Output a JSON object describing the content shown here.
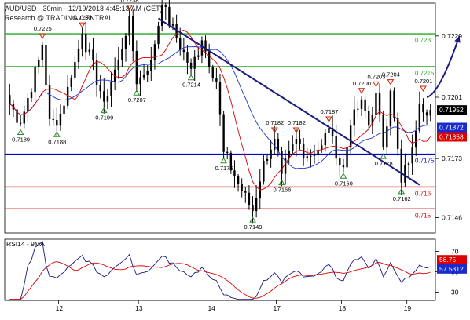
{
  "header": {
    "instrument_line": "AUD/USD - 30min - 12/19/2018 4:45:13 AM (CET)",
    "research_line": "Research @ TRADING CENTRAL"
  },
  "colors": {
    "candle": "#000000",
    "ma_fast": "#dd0000",
    "ma_slow": "#2233cc",
    "trendline": "#1a1a80",
    "resistance": "#22aa22",
    "pivot": "#0000cc",
    "support": "#cc0000",
    "marker_up": "#2a8a2a",
    "marker_down": "#cc2200",
    "badge_price": "#000000",
    "badge_slow": "#1a2acc",
    "badge_fast": "#dd0000",
    "rsi_line": "#1a1a80",
    "rsi_ma": "#dd0000"
  },
  "chart_data": [
    {
      "type": "candlestick",
      "title": "AUD/USD - 30min",
      "ylim": [
        0.7139,
        0.7244
      ],
      "x_tick_labels": [
        "12",
        "13",
        "14",
        "17",
        "18",
        "19"
      ],
      "y_tick_labels": [
        {
          "label": "0.7229",
          "value": 0.7229
        },
        {
          "label": "0.7201",
          "value": 0.7201
        },
        {
          "label": "0.7173",
          "value": 0.7173
        },
        {
          "label": "0.7146",
          "value": 0.7146
        }
      ],
      "anchor_points": [
        {
          "bar": 0,
          "price": 0.7198
        },
        {
          "bar": 3,
          "price": 0.7189
        },
        {
          "bar": 8,
          "price": 0.7218
        },
        {
          "bar": 9,
          "price": 0.7225
        },
        {
          "bar": 11,
          "price": 0.7191
        },
        {
          "bar": 13,
          "price": 0.7188
        },
        {
          "bar": 17,
          "price": 0.721
        },
        {
          "bar": 20,
          "price": 0.723
        },
        {
          "bar": 26,
          "price": 0.7199
        },
        {
          "bar": 30,
          "price": 0.7218
        },
        {
          "bar": 33,
          "price": 0.7238
        },
        {
          "bar": 35,
          "price": 0.7207
        },
        {
          "bar": 39,
          "price": 0.7218
        },
        {
          "bar": 42,
          "price": 0.7243
        },
        {
          "bar": 46,
          "price": 0.7228
        },
        {
          "bar": 50,
          "price": 0.7214
        },
        {
          "bar": 53,
          "price": 0.7227
        },
        {
          "bar": 57,
          "price": 0.7208
        },
        {
          "bar": 59,
          "price": 0.7176
        },
        {
          "bar": 64,
          "price": 0.7158
        },
        {
          "bar": 67,
          "price": 0.7149
        },
        {
          "bar": 70,
          "price": 0.7172
        },
        {
          "bar": 73,
          "price": 0.7182
        },
        {
          "bar": 75,
          "price": 0.7166
        },
        {
          "bar": 79,
          "price": 0.7182
        },
        {
          "bar": 82,
          "price": 0.7174
        },
        {
          "bar": 86,
          "price": 0.7179
        },
        {
          "bar": 88,
          "price": 0.7187
        },
        {
          "bar": 90,
          "price": 0.7173
        },
        {
          "bar": 92,
          "price": 0.7169
        },
        {
          "bar": 94,
          "price": 0.7188
        },
        {
          "bar": 97,
          "price": 0.72
        },
        {
          "bar": 99,
          "price": 0.7188
        },
        {
          "bar": 101,
          "price": 0.7203
        },
        {
          "bar": 103,
          "price": 0.7178
        },
        {
          "bar": 105,
          "price": 0.7204
        },
        {
          "bar": 108,
          "price": 0.7162
        },
        {
          "bar": 111,
          "price": 0.7178
        },
        {
          "bar": 113,
          "price": 0.7198
        },
        {
          "bar": 116,
          "price": 0.7195
        }
      ],
      "bars_count": 117,
      "day_start_bars": {
        "12": 14,
        "13": 36,
        "14": 56,
        "17": 74,
        "18": 92,
        "19": 110
      },
      "horizontal_levels": [
        {
          "label": "0.723",
          "value": 0.723,
          "role": "resistance"
        },
        {
          "label": "0.7215",
          "value": 0.7215,
          "role": "resistance"
        },
        {
          "label": "0.7175",
          "value": 0.7175,
          "role": "pivot"
        },
        {
          "label": "0.716",
          "value": 0.716,
          "role": "support"
        },
        {
          "label": "0.715",
          "value": 0.715,
          "role": "support"
        }
      ],
      "trendline": [
        {
          "bar": 41,
          "price": 0.7237
        },
        {
          "bar": 113,
          "price": 0.7161
        }
      ],
      "projection_arrow": [
        {
          "bar": 115,
          "price": 0.7201
        },
        {
          "bar": 124,
          "price": 0.7229
        }
      ],
      "annotations": [
        {
          "label": "0.7225",
          "bar": 9,
          "price": 0.7225,
          "kind": "high"
        },
        {
          "label": "0.7230",
          "bar": 20,
          "price": 0.723,
          "kind": "high"
        },
        {
          "label": "0.7238",
          "bar": 33,
          "price": 0.7238,
          "kind": "high"
        },
        {
          "label": "0.7189",
          "bar": 3,
          "price": 0.7189,
          "kind": "low"
        },
        {
          "label": "0.7188",
          "bar": 13,
          "price": 0.7188,
          "kind": "low"
        },
        {
          "label": "0.7199",
          "bar": 26,
          "price": 0.7199,
          "kind": "low"
        },
        {
          "label": "0.7207",
          "bar": 35,
          "price": 0.7207,
          "kind": "low"
        },
        {
          "label": "0.7214",
          "bar": 50,
          "price": 0.7214,
          "kind": "low"
        },
        {
          "label": "0.7176",
          "bar": 59,
          "price": 0.7176,
          "kind": "low"
        },
        {
          "label": "0.7149",
          "bar": 67,
          "price": 0.7149,
          "kind": "low"
        },
        {
          "label": "0.7182",
          "bar": 73,
          "price": 0.7182,
          "kind": "high"
        },
        {
          "label": "0.7182",
          "bar": 79,
          "price": 0.7182,
          "kind": "high"
        },
        {
          "label": "0.7166",
          "bar": 75,
          "price": 0.7166,
          "kind": "low"
        },
        {
          "label": "0.7187",
          "bar": 88,
          "price": 0.7187,
          "kind": "high"
        },
        {
          "label": "0.7169",
          "bar": 92,
          "price": 0.7169,
          "kind": "low"
        },
        {
          "label": "0.7200",
          "bar": 97,
          "price": 0.72,
          "kind": "high"
        },
        {
          "label": "0.7203",
          "bar": 101,
          "price": 0.7203,
          "kind": "high"
        },
        {
          "label": "0.7204",
          "bar": 105,
          "price": 0.7204,
          "kind": "high"
        },
        {
          "label": "0.7178",
          "bar": 103,
          "price": 0.7178,
          "kind": "low"
        },
        {
          "label": "0.7162",
          "bar": 108,
          "price": 0.7162,
          "kind": "low"
        },
        {
          "label": "0.7201",
          "bar": 114,
          "price": 0.7201,
          "kind": "high"
        }
      ],
      "price_badges": [
        {
          "label": "0.71952",
          "value": 0.71952,
          "color_key": "badge_price"
        },
        {
          "label": "0.71872",
          "value": 0.71872,
          "color_key": "badge_slow"
        },
        {
          "label": "0.71858",
          "value": 0.71858,
          "color_key": "badge_fast"
        }
      ],
      "ma_fast_period": 9,
      "ma_slow_period": 21
    },
    {
      "type": "line",
      "title": "RSI14 - 9MA",
      "ylim": [
        22,
        82
      ],
      "y_tick_labels": [
        {
          "label": "70",
          "value": 70
        },
        {
          "label": "50",
          "value": 50
        },
        {
          "label": "30",
          "value": 30
        }
      ],
      "series": [
        {
          "name": "RSI14",
          "color_key": "rsi_line"
        },
        {
          "name": "9MA",
          "color_key": "rsi_ma"
        }
      ],
      "rsi_period": 14,
      "ma_period": 9,
      "value_badges": [
        {
          "label": "58.75",
          "value": 58.75,
          "color_key": "badge_fast"
        },
        {
          "label": "57.5312",
          "value": 57.5312,
          "color_key": "badge_slow"
        }
      ]
    }
  ]
}
